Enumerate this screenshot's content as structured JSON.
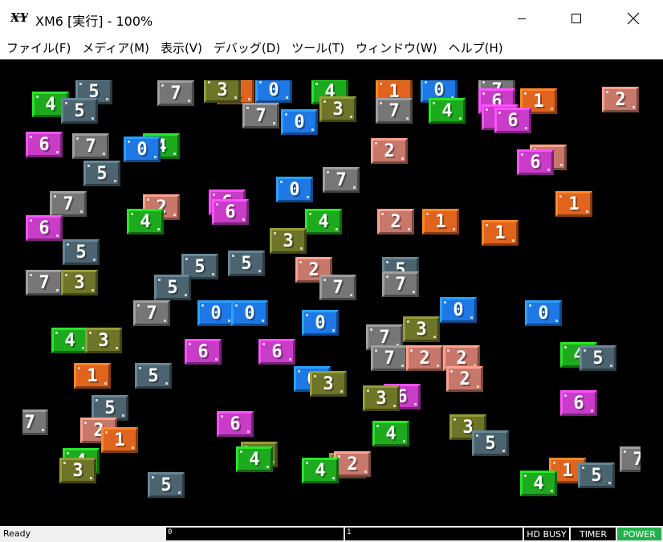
{
  "window": {
    "title": "XM6 [実行] - 100%",
    "icon": "xm6-app-icon"
  },
  "menu": [
    {
      "label": "ファイル(F)"
    },
    {
      "label": "メディア(M)"
    },
    {
      "label": "表示(V)"
    },
    {
      "label": "デバッグ(D)"
    },
    {
      "label": "ツール(T)"
    },
    {
      "label": "ウィンドウ(W)"
    },
    {
      "label": "ヘルプ(H)"
    }
  ],
  "palette": {
    "0": "#1e78e6",
    "1": "#e0641e",
    "2": "#c8786a",
    "3": "#6e7428",
    "4": "#1eaa1e",
    "5": "#4c6470",
    "6": "#c83cc8",
    "7": "#767676"
  },
  "tiles": [
    {
      "n": "7"
    },
    {
      "n": "5"
    },
    {
      "n": "1"
    },
    {
      "n": "0"
    },
    {
      "n": "3"
    },
    {
      "n": "4"
    },
    {
      "n": "1"
    },
    {
      "n": "0"
    },
    {
      "n": "7"
    },
    {
      "n": "6"
    },
    {
      "n": "1"
    },
    {
      "n": "2"
    },
    {
      "n": "4"
    },
    {
      "n": "5"
    },
    {
      "n": "7"
    },
    {
      "n": "0"
    },
    {
      "n": "3"
    },
    {
      "n": "7"
    },
    {
      "n": "4"
    },
    {
      "n": "6"
    },
    {
      "n": "6"
    },
    {
      "n": "6"
    },
    {
      "n": "4"
    },
    {
      "n": "0"
    },
    {
      "n": "7"
    },
    {
      "n": "2"
    },
    {
      "n": "2"
    },
    {
      "n": "6"
    },
    {
      "n": "0"
    },
    {
      "n": "7"
    },
    {
      "n": "5"
    },
    {
      "n": "7"
    },
    {
      "n": "2"
    },
    {
      "n": "6"
    },
    {
      "n": "1"
    },
    {
      "n": "6"
    },
    {
      "n": "4"
    },
    {
      "n": "4"
    },
    {
      "n": "2"
    },
    {
      "n": "1"
    },
    {
      "n": "1"
    },
    {
      "n": "6"
    },
    {
      "n": "3"
    },
    {
      "n": "5"
    },
    {
      "n": "5"
    },
    {
      "n": "5"
    },
    {
      "n": "2"
    },
    {
      "n": "5"
    },
    {
      "n": "7"
    },
    {
      "n": "3"
    },
    {
      "n": "7"
    },
    {
      "n": "5"
    },
    {
      "n": "7"
    },
    {
      "n": "7"
    },
    {
      "n": "0"
    },
    {
      "n": "0"
    },
    {
      "n": "0"
    },
    {
      "n": "0"
    },
    {
      "n": "0"
    },
    {
      "n": "7"
    },
    {
      "n": "3"
    },
    {
      "n": "4"
    },
    {
      "n": "3"
    },
    {
      "n": "6"
    },
    {
      "n": "6"
    },
    {
      "n": "7"
    },
    {
      "n": "2"
    },
    {
      "n": "2"
    },
    {
      "n": "4"
    },
    {
      "n": "5"
    },
    {
      "n": "1"
    },
    {
      "n": "5"
    },
    {
      "n": "0"
    },
    {
      "n": "3"
    },
    {
      "n": "2"
    },
    {
      "n": "6"
    },
    {
      "n": "3"
    },
    {
      "n": "6"
    },
    {
      "n": "5"
    },
    {
      "n": "2"
    },
    {
      "n": "1"
    },
    {
      "n": "6"
    },
    {
      "n": "3"
    },
    {
      "n": "4"
    },
    {
      "n": "3"
    },
    {
      "n": "5"
    },
    {
      "n": "4"
    },
    {
      "n": "3"
    },
    {
      "n": "4"
    },
    {
      "n": "2"
    },
    {
      "n": "3"
    },
    {
      "n": "5"
    },
    {
      "n": "4"
    },
    {
      "n": "1"
    },
    {
      "n": "5"
    },
    {
      "n": "7"
    },
    {
      "n": "4"
    },
    {
      "n": "7"
    }
  ],
  "status": {
    "ready": "Ready",
    "drive0": "0",
    "drive1": "1",
    "hd_busy": "HD BUSY",
    "timer": "TIMER",
    "power": "POWER",
    "power_color": "#22b14c"
  }
}
